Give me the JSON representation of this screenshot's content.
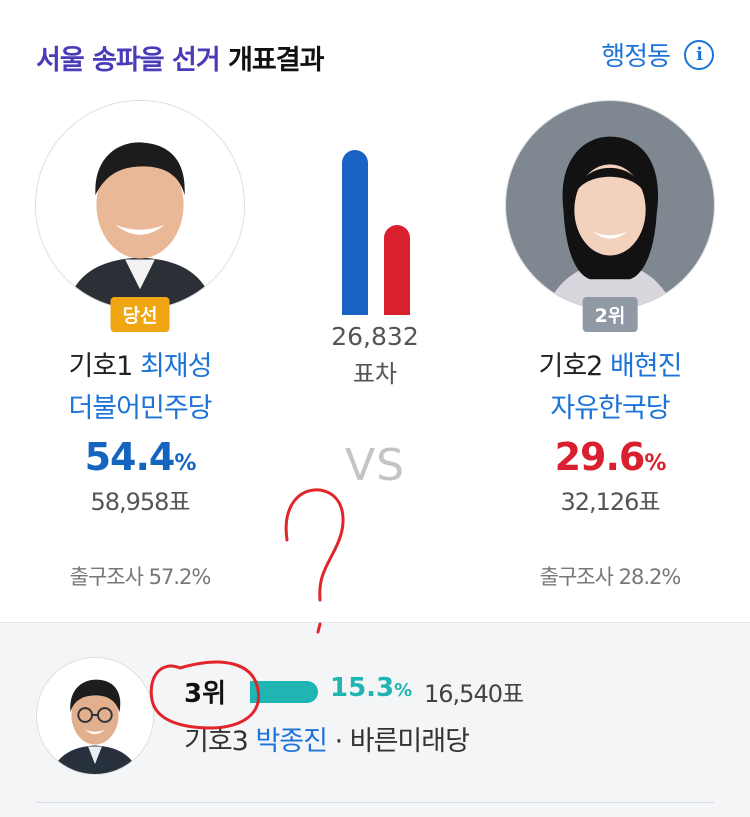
{
  "header": {
    "title_accent": "서울 송파을 선거",
    "title_plain": "개표결과",
    "district_link": "행정동",
    "info_icon": "info-icon"
  },
  "candidates": [
    {
      "badge": "당선",
      "number_label": "기호1",
      "name": "최재성",
      "party": "더불어민주당",
      "percent": "54.4",
      "percent_symbol": "%",
      "votes": "58,958표",
      "exit_poll": "출구조사 57.2%",
      "color": "#1b62c5"
    },
    {
      "badge": "2위",
      "number_label": "기호2",
      "name": "배현진",
      "party": "자유한국당",
      "percent": "29.6",
      "percent_symbol": "%",
      "votes": "32,126표",
      "exit_poll": "출구조사 28.2%",
      "color": "#d8202e"
    }
  ],
  "comparison": {
    "difference": "26,832",
    "difference_label": "표차",
    "vs_label": "VS"
  },
  "third": {
    "rank": "3위",
    "percent": "15.3",
    "percent_symbol": "%",
    "votes": "16,540표",
    "number_label": "기호3",
    "name": "박종진",
    "party": "· 바른미래당",
    "color": "#1fb5b3"
  },
  "annotation": {
    "question_mark_color": "#e2242b"
  }
}
